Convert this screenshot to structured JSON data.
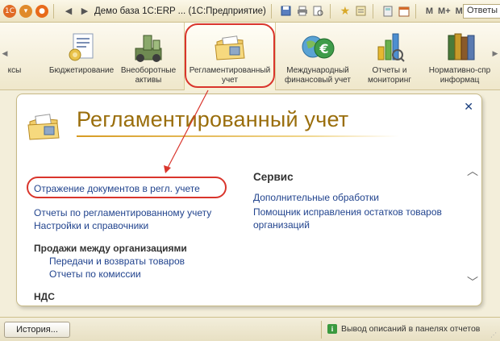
{
  "titlebar": {
    "title": "Демо база 1С:ERP ...  (1С:Предприятие)",
    "m_labels": [
      "M",
      "M+",
      "M-"
    ],
    "search_label": "Ответы"
  },
  "sections": [
    {
      "label": "ксы",
      "icon": "partial-section-icon"
    },
    {
      "label": "Бюджетирование",
      "icon": "budgeting-icon"
    },
    {
      "label": "Внеоборотные\nактивы",
      "icon": "fixed-assets-icon"
    },
    {
      "label": "Регламентированный\nучет",
      "icon": "regulated-accounting-icon"
    },
    {
      "label": "Международный\nфинансовый учет",
      "icon": "international-finance-icon"
    },
    {
      "label": "Отчеты и\nмониторинг",
      "icon": "reports-chart-icon"
    },
    {
      "label": "Нормативно-спр\nинформац",
      "icon": "reference-books-icon"
    }
  ],
  "panel": {
    "title": "Регламентированный учет",
    "left": {
      "link_reflection": "Отражение документов в регл. учете",
      "link_reports": "Отчеты по регламентированному учету",
      "link_settings": "Настройки и справочники",
      "group_sales_heading": "Продажи между организациями",
      "link_transfers": "Передачи и возвраты товаров",
      "link_commission": "Отчеты по комиссии",
      "group_vat_heading": "НДС"
    },
    "right": {
      "heading": "Сервис",
      "link_processing": "Дополнительные обработки",
      "link_helper_line1": "Помощник исправления остатков товаров",
      "link_helper_line2": "организаций"
    }
  },
  "statusbar": {
    "history_label": "История...",
    "info_text": "Вывод описаний в панелях отчетов"
  },
  "colors": {
    "highlight": "#d9352c",
    "link": "#22448e",
    "title": "#9a6e0c"
  }
}
